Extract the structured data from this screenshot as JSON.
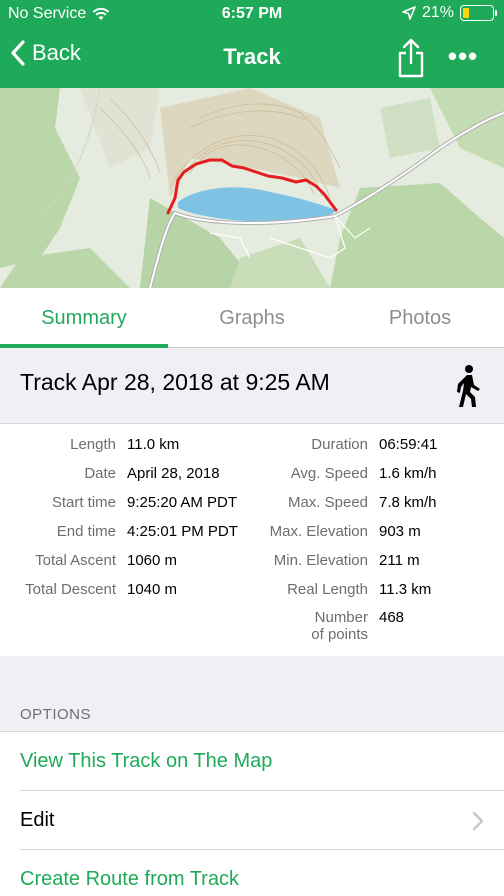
{
  "status_bar": {
    "carrier": "No Service",
    "time": "6:57 PM",
    "battery": "21%",
    "battery_level": 0.21
  },
  "navbar": {
    "back_label": "Back",
    "title": "Track",
    "share_icon": "share-icon",
    "more_icon": "more-icon",
    "more_glyph": "•••"
  },
  "map": {
    "description_icon": "topographic-map",
    "track_color": "#e41e1e"
  },
  "tabs": [
    {
      "label": "Summary",
      "active": true
    },
    {
      "label": "Graphs",
      "active": false
    },
    {
      "label": "Photos",
      "active": false
    }
  ],
  "track": {
    "title": "Track Apr 28, 2018 at 9:25 AM",
    "activity_icon": "walking-person-icon"
  },
  "stats_left": [
    {
      "label": "Length",
      "value": "11.0 km"
    },
    {
      "label": "Date",
      "value": "April 28, 2018"
    },
    {
      "label": "Start time",
      "value": "9:25:20 AM PDT"
    },
    {
      "label": "End time",
      "value": "4:25:01 PM PDT"
    },
    {
      "label": "Total Ascent",
      "value": "1060 m"
    },
    {
      "label": "Total Descent",
      "value": "1040 m"
    }
  ],
  "stats_right": [
    {
      "label": "Duration",
      "value": "06:59:41"
    },
    {
      "label": "Avg. Speed",
      "value": "1.6 km/h"
    },
    {
      "label": "Max. Speed",
      "value": "7.8 km/h"
    },
    {
      "label": "Max. Elevation",
      "value": "903 m"
    },
    {
      "label": "Min. Elevation",
      "value": "211 m"
    },
    {
      "label": "Real Length",
      "value": "11.3 km"
    },
    {
      "label_line1": "Number",
      "label_line2": "of points",
      "value": "468"
    }
  ],
  "options": {
    "header": "OPTIONS",
    "items": [
      {
        "label": "View This Track on The Map",
        "style": "green"
      },
      {
        "label": "Edit",
        "style": "plain",
        "chevron": true
      },
      {
        "label": "Create Route from Track",
        "style": "green"
      }
    ]
  },
  "colors": {
    "accent": "#1faa59",
    "background_grouped": "#efeff4",
    "secondary_text": "#6d6d72"
  }
}
